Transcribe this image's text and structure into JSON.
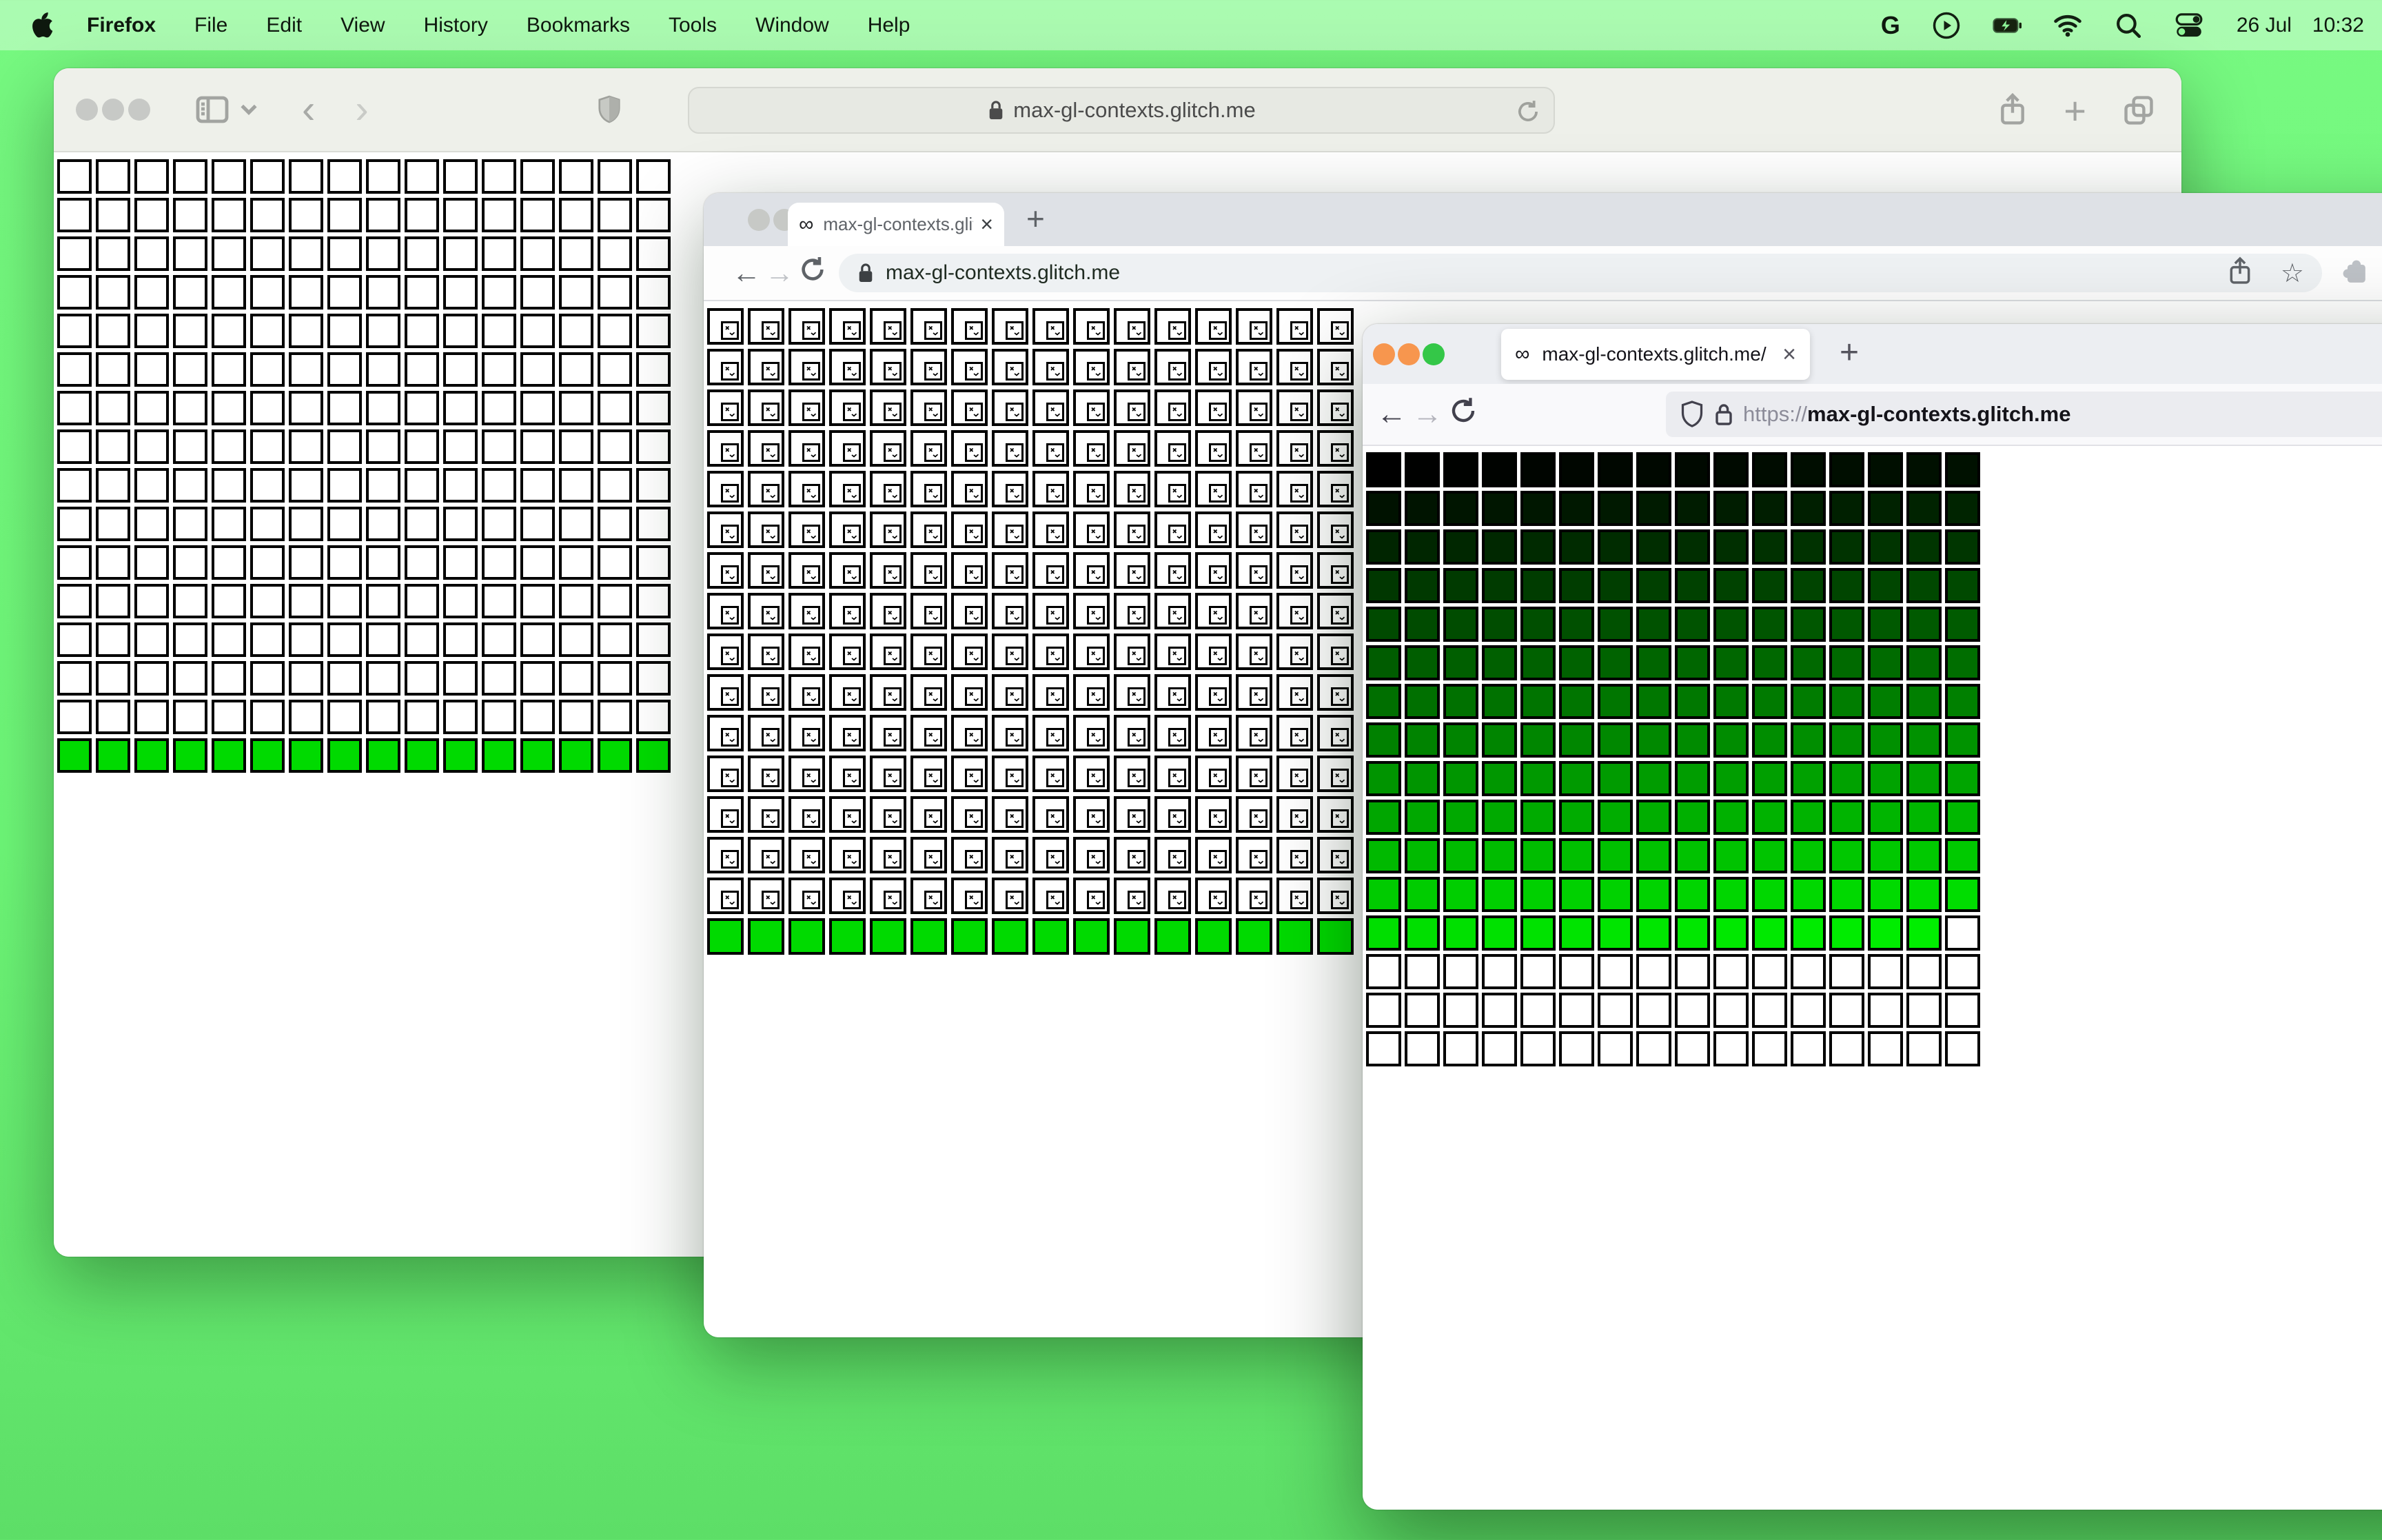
{
  "menu_bar": {
    "app_name": "Firefox",
    "items": [
      "File",
      "Edit",
      "View",
      "History",
      "Bookmarks",
      "Tools",
      "Window",
      "Help"
    ],
    "google_glyph": "G",
    "date": "26 Jul",
    "time": "10:32"
  },
  "icons": {
    "favicon_infinity": "∞",
    "close": "×",
    "new_tab": "+",
    "back_arrow": "←",
    "forward_arrow": "→",
    "back_chevron": "‹",
    "forward_chevron": "›",
    "star": "☆"
  },
  "safari_window": {
    "url": "max-gl-contexts.glitch.me"
  },
  "chrome_window": {
    "tab_title": "max-gl-contexts.glitch.me",
    "url": "max-gl-contexts.glitch.me"
  },
  "firefox_window": {
    "tab_title": "max-gl-contexts.glitch.me/",
    "url_scheme": "https://",
    "url_host": "max-gl-contexts.glitch.me"
  },
  "grids": {
    "safari": {
      "mode": "bottom_green",
      "cols": 16,
      "rows": 16,
      "green": "#00da00",
      "empty": "#ffffff"
    },
    "chrome": {
      "mode": "broken_bottom_green",
      "cols": 16,
      "rows": 16,
      "green": "#00da00",
      "empty": "#ffffff"
    },
    "firefox": {
      "mode": "gradient",
      "cols": 16,
      "rows": 16,
      "colored_cells": 207,
      "max_green": 238,
      "empty": "#ffffff"
    }
  },
  "colors": {
    "desktop_green": "#6ef878",
    "cell_green": "#00da00",
    "traffic_orange": "#f7964e",
    "traffic_green": "#34c748"
  }
}
